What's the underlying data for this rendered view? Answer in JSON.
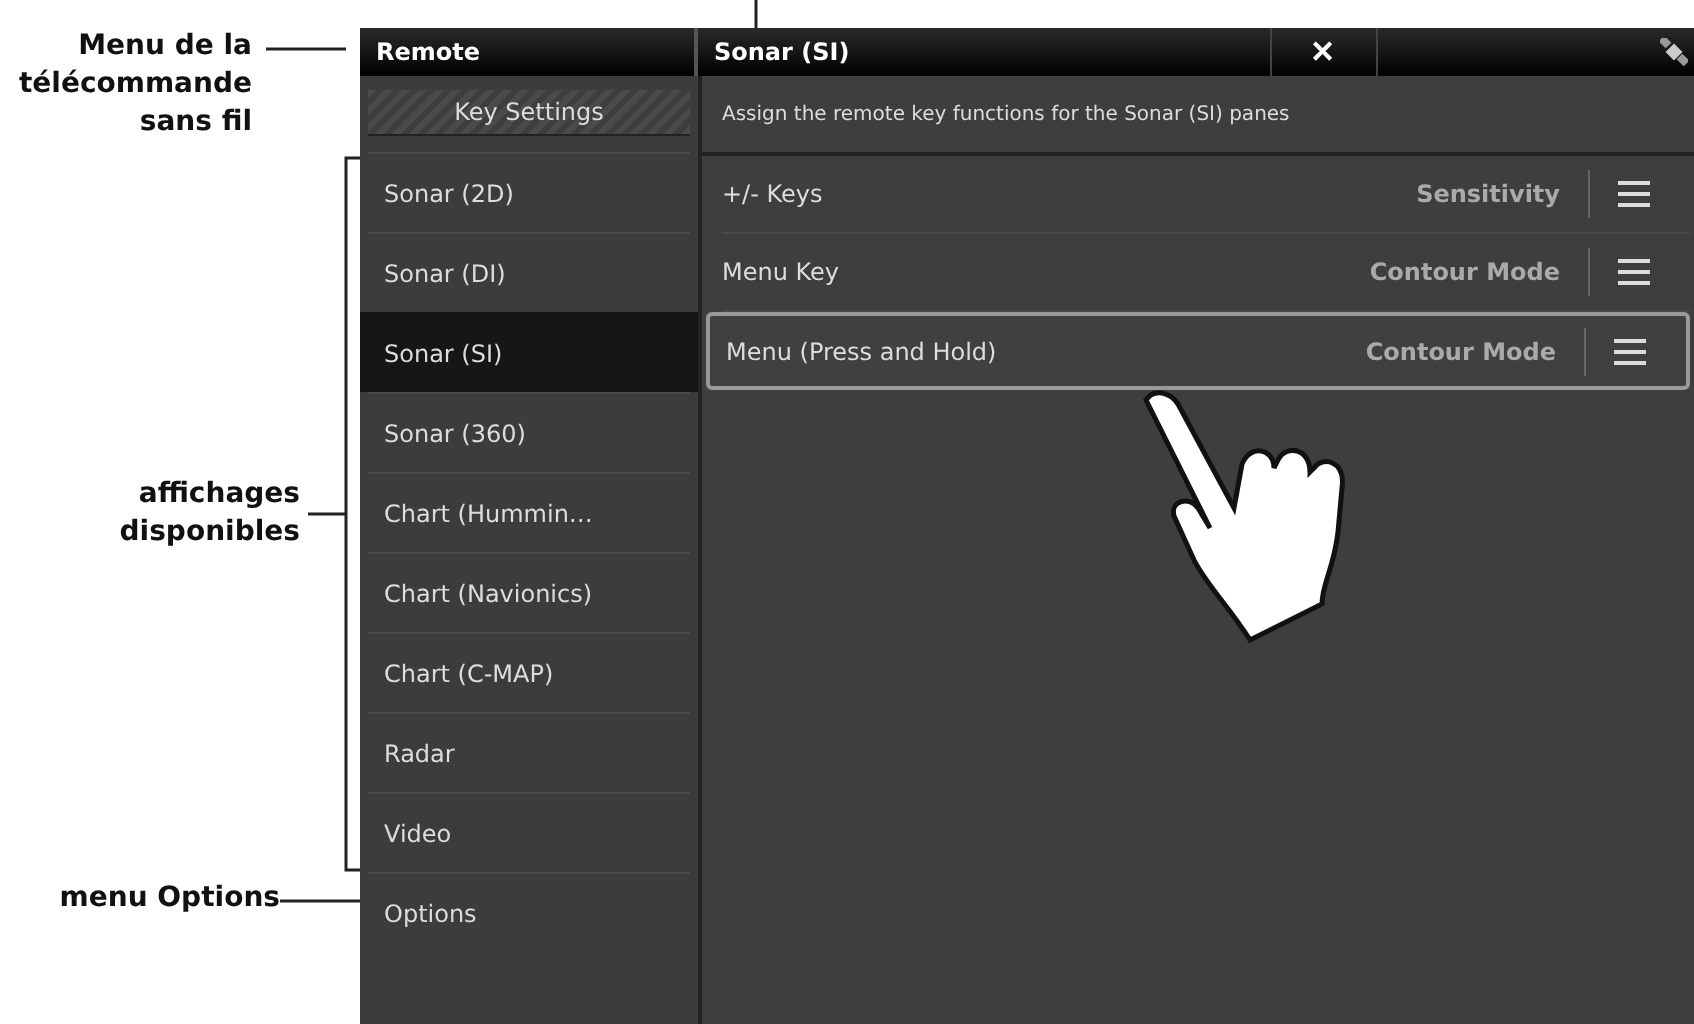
{
  "callouts": [
    {
      "text": "Menu de la télécommande sans fil",
      "kind": "point"
    },
    {
      "text": "affichages disponibles",
      "kind": "bracket"
    },
    {
      "text": "menu Options",
      "kind": "point"
    }
  ],
  "header": {
    "left_title": "Remote",
    "right_title": "Sonar (SI)",
    "close": "✕"
  },
  "sidebar": {
    "button": "Key Settings",
    "items": [
      {
        "label": "Sonar (2D)",
        "selected": false
      },
      {
        "label": "Sonar (DI)",
        "selected": false
      },
      {
        "label": "Sonar (SI)",
        "selected": true
      },
      {
        "label": "Sonar (360)",
        "selected": false
      },
      {
        "label": "Chart (Hummin…",
        "selected": false
      },
      {
        "label": "Chart (Navionics)",
        "selected": false
      },
      {
        "label": "Chart (C-MAP)",
        "selected": false
      },
      {
        "label": "Radar",
        "selected": false
      },
      {
        "label": "Video",
        "selected": false
      },
      {
        "label": "Options",
        "selected": false
      }
    ]
  },
  "panel": {
    "description": "Assign the remote key functions for the Sonar (SI) panes",
    "rows": [
      {
        "key": "+/- Keys",
        "function": "Sensitivity",
        "selected": false
      },
      {
        "key": "Menu Key",
        "function": "Contour Mode",
        "selected": false
      },
      {
        "key": "Menu (Press and Hold)",
        "function": "Contour Mode",
        "selected": true
      }
    ]
  }
}
